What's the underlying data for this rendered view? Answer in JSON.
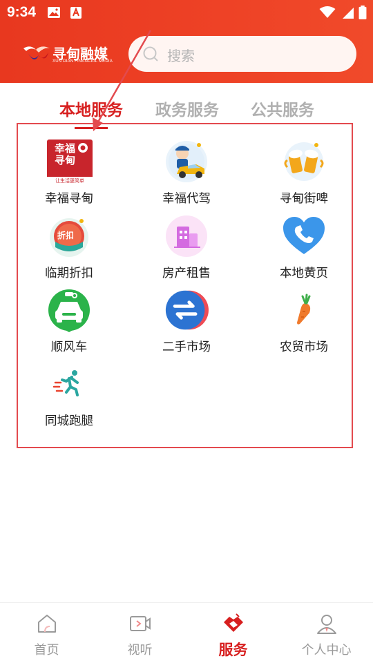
{
  "statusbar": {
    "time": "9:34"
  },
  "header": {
    "logo_title": "寻甸融媒",
    "logo_subtitle": "XUN DIAN FINANCIAL MEDIA",
    "search_placeholder": "搜索"
  },
  "tabs": [
    {
      "label": "本地服务",
      "active": true
    },
    {
      "label": "政务服务",
      "active": false
    },
    {
      "label": "公共服务",
      "active": false
    }
  ],
  "services": [
    {
      "label": "幸福寻甸",
      "icon": "xingfu-xundian-logo-icon",
      "logo_text": "幸福寻甸",
      "logo_caption": "让生活更简单"
    },
    {
      "label": "幸福代驾",
      "icon": "driver-car-icon"
    },
    {
      "label": "寻甸街啤",
      "icon": "beer-mugs-icon"
    },
    {
      "label": "临期折扣",
      "icon": "discount-tag-icon",
      "badge": "折扣"
    },
    {
      "label": "房产租售",
      "icon": "building-icon"
    },
    {
      "label": "本地黄页",
      "icon": "phone-heart-icon"
    },
    {
      "label": "顺风车",
      "icon": "taxi-icon"
    },
    {
      "label": "二手市场",
      "icon": "exchange-arrows-icon"
    },
    {
      "label": "农贸市场",
      "icon": "carrot-icon"
    },
    {
      "label": "同城跑腿",
      "icon": "running-man-icon"
    }
  ],
  "bottom_nav": [
    {
      "label": "首页",
      "icon": "home-icon",
      "active": false
    },
    {
      "label": "视听",
      "icon": "video-icon",
      "active": false
    },
    {
      "label": "服务",
      "icon": "service-handshake-icon",
      "active": true
    },
    {
      "label": "个人中心",
      "icon": "user-icon",
      "active": false
    }
  ],
  "colors": {
    "header_red": "#ee4226",
    "active_red": "#d71f1f",
    "annotation": "#e34a4e"
  }
}
